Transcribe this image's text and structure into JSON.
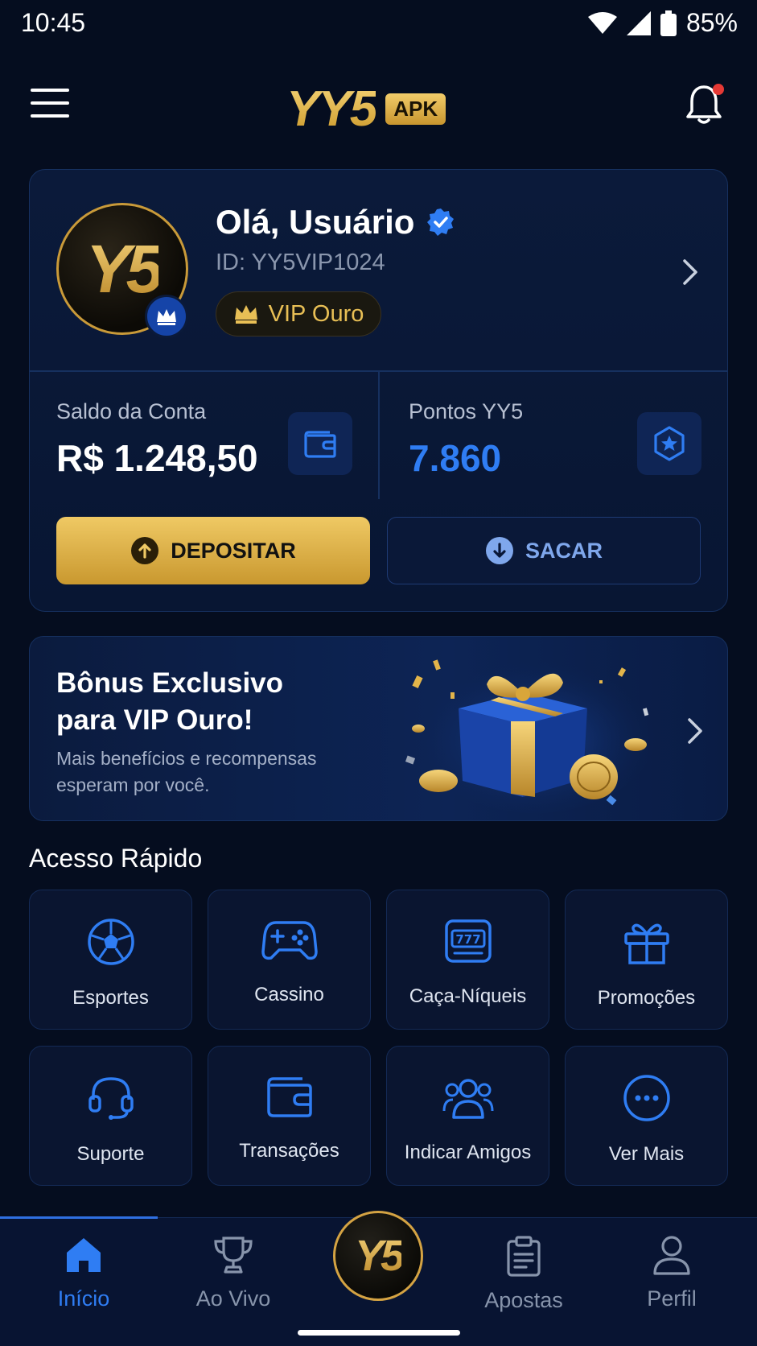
{
  "status_bar": {
    "time": "10:45",
    "battery": "85%"
  },
  "header": {
    "logo": "YY5",
    "logo_badge": "APK"
  },
  "profile": {
    "greeting": "Olá, Usuário",
    "user_id": "ID: YY5VIP1024",
    "vip_level": "VIP Ouro",
    "avatar_logo": "Y5"
  },
  "balance": {
    "label": "Saldo da Conta",
    "value": "R$ 1.248,50"
  },
  "points": {
    "label": "Pontos YY5",
    "value": "7.860"
  },
  "actions": {
    "deposit": "DEPOSITAR",
    "withdraw": "SACAR"
  },
  "banner": {
    "title": "Bônus Exclusivo para VIP Ouro!",
    "subtitle": "Mais benefícios e recompensas esperam por você."
  },
  "quick_access": {
    "title": "Acesso Rápido",
    "items": [
      {
        "label": "Esportes",
        "icon": "soccer-ball-icon"
      },
      {
        "label": "Cassino",
        "icon": "gamepad-icon"
      },
      {
        "label": "Caça-Níqueis",
        "icon": "slot-machine-icon"
      },
      {
        "label": "Promoções",
        "icon": "gift-icon"
      },
      {
        "label": "Suporte",
        "icon": "headset-icon"
      },
      {
        "label": "Transações",
        "icon": "wallet-icon"
      },
      {
        "label": "Indicar Amigos",
        "icon": "users-icon"
      },
      {
        "label": "Ver Mais",
        "icon": "more-icon"
      }
    ]
  },
  "bottom_nav": {
    "items": [
      {
        "label": "Início",
        "icon": "home-icon",
        "active": true
      },
      {
        "label": "Ao Vivo",
        "icon": "trophy-icon"
      },
      {
        "label": "Y5",
        "icon": "center-logo"
      },
      {
        "label": "Apostas",
        "icon": "clipboard-icon"
      },
      {
        "label": "Perfil",
        "icon": "user-icon"
      }
    ]
  },
  "colors": {
    "background": "#050d1f",
    "gold": "#e3b54a",
    "accent_blue": "#2f7df3",
    "card": "#0b1a3a"
  }
}
